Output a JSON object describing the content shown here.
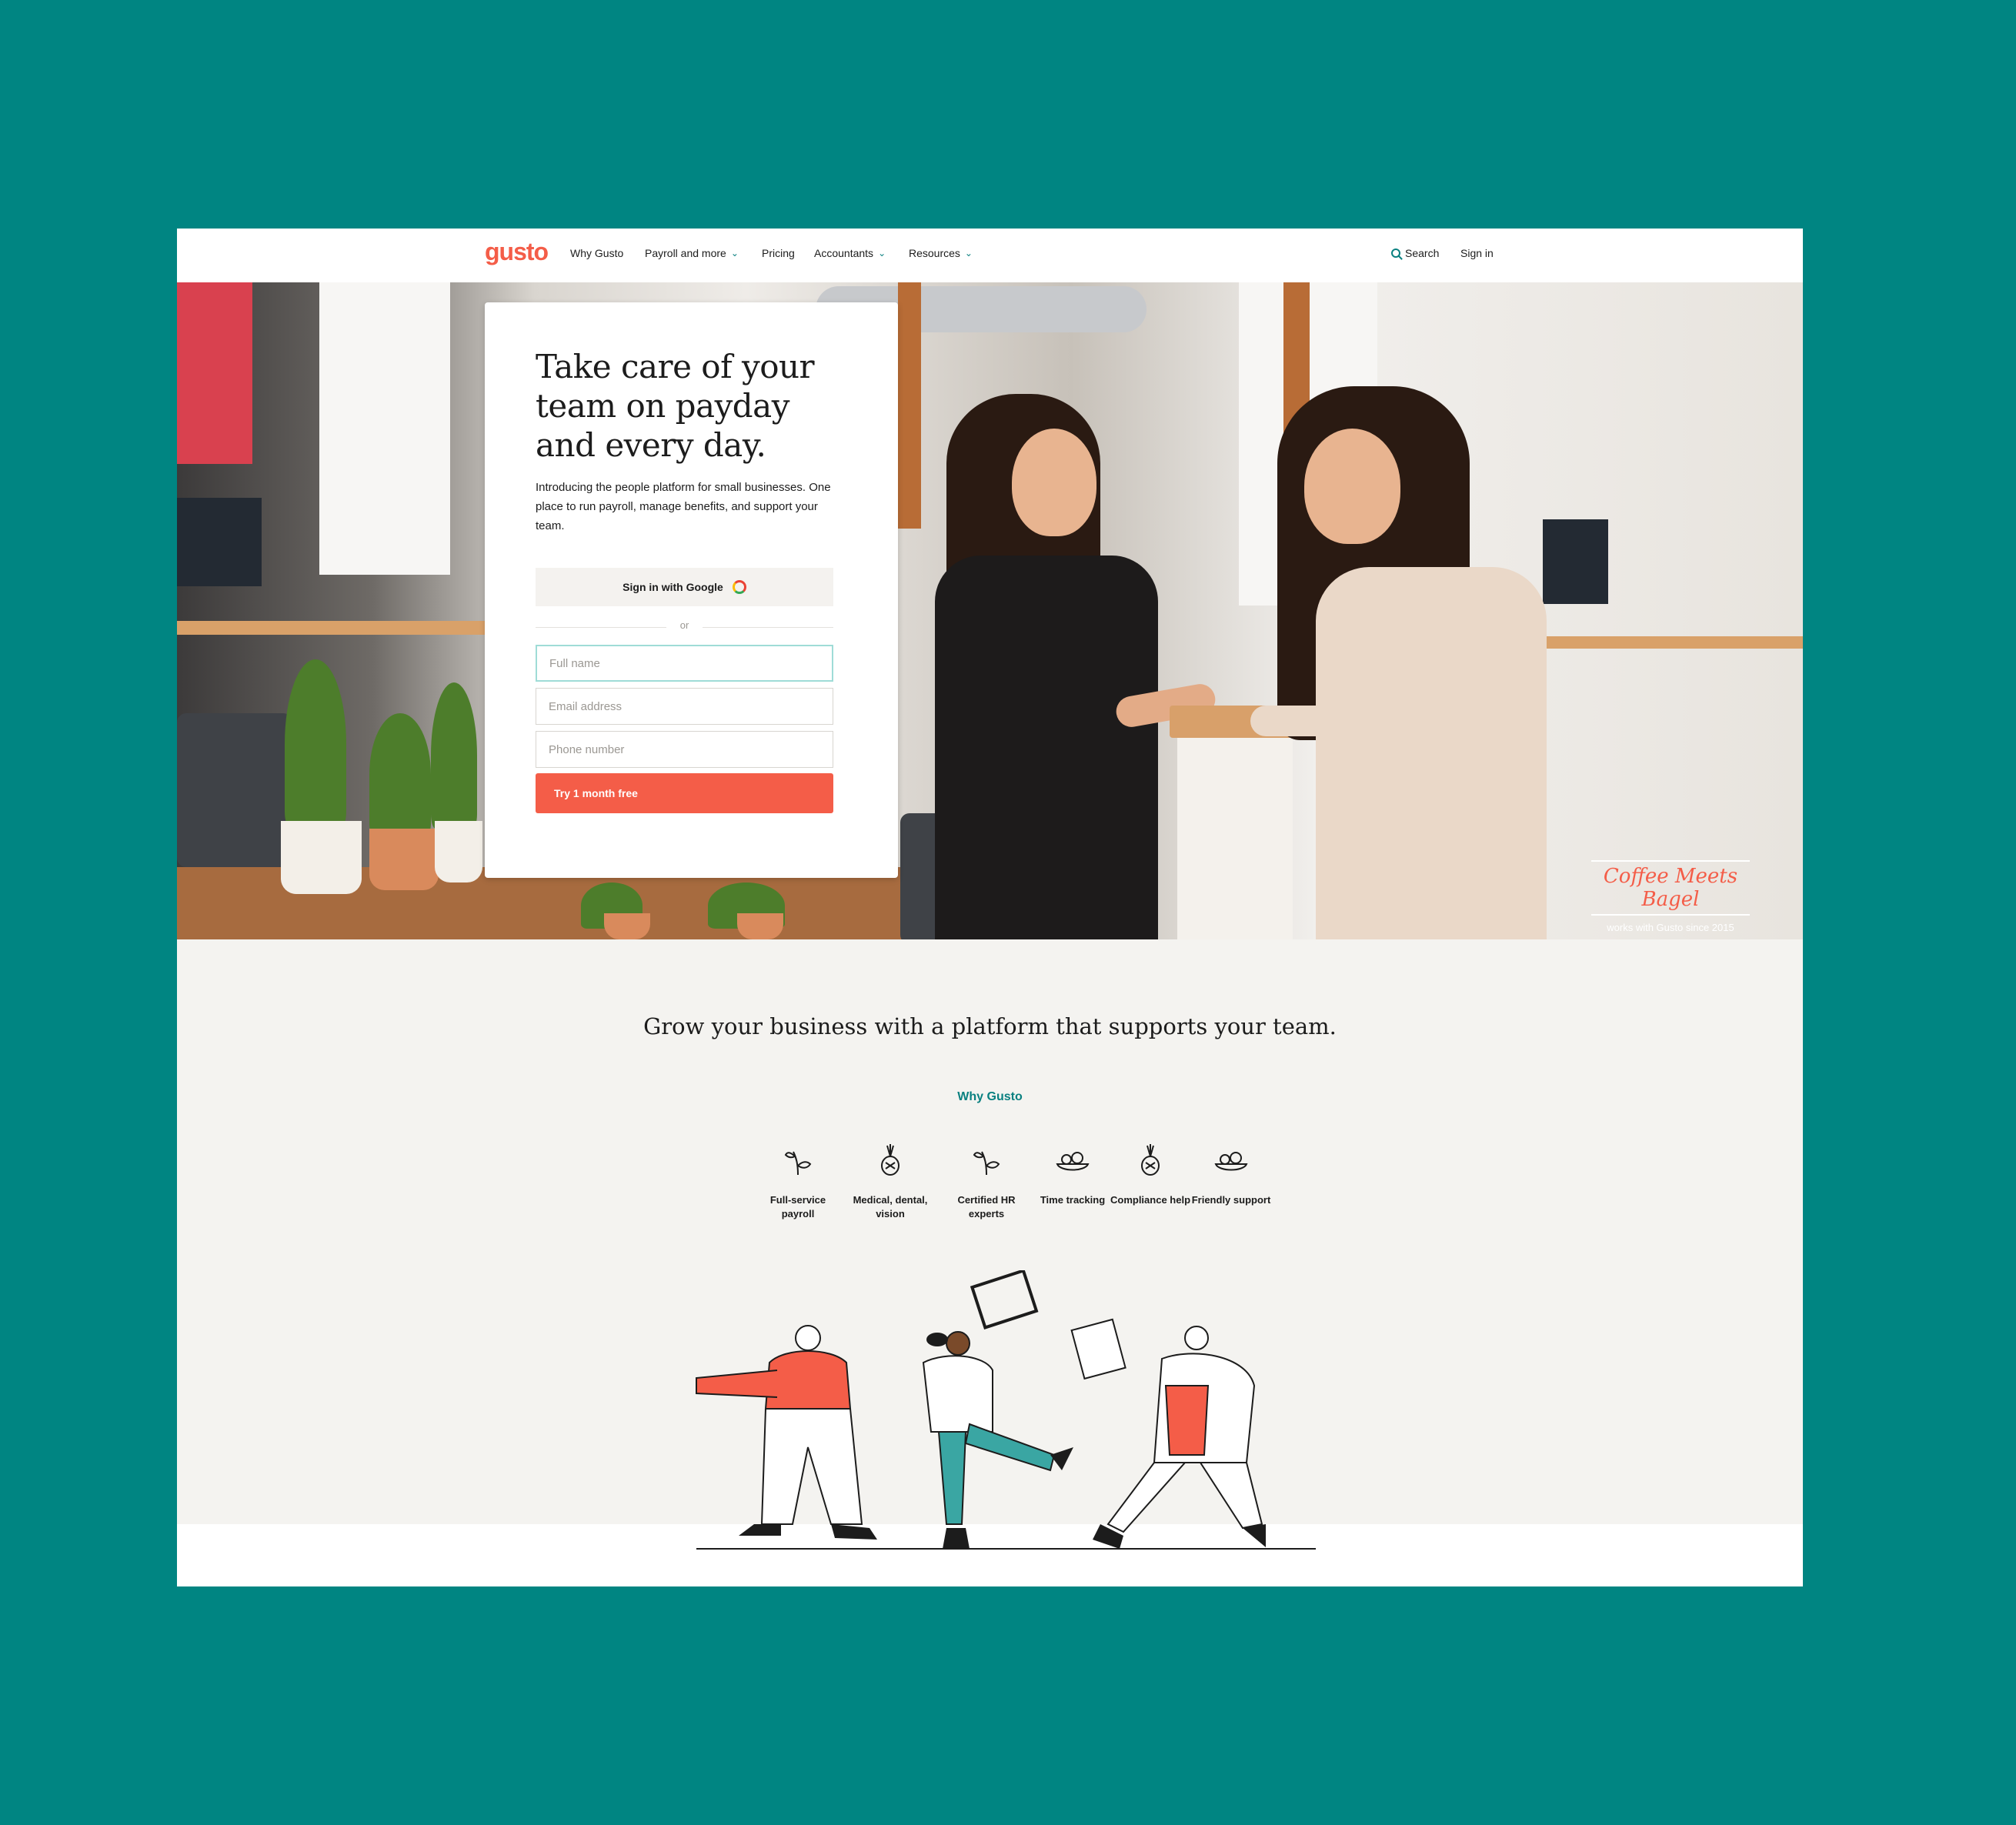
{
  "nav": {
    "logo": "gusto",
    "links": [
      "Why Gusto",
      "Payroll and more",
      "Pricing",
      "Accountants",
      "Resources"
    ],
    "search": "Search",
    "sign_in": "Sign in"
  },
  "hero": {
    "heading": "Take care of your team on payday and every day.",
    "intro": "Introducing the people platform for small businesses. One place to run payroll, manage benefits, and support your team.",
    "google_button": "Sign in with Google",
    "divider": "or",
    "fields": {
      "full_name_placeholder": "Full name",
      "email_placeholder": "Email address",
      "phone_placeholder": "Phone number"
    },
    "cta": "Try 1 month free",
    "badge_title": "Coffee Meets Bagel",
    "badge_sub": "works with Gusto since 2015"
  },
  "lower": {
    "heading": "Grow your business with a platform that supports your team.",
    "why_link": "Why Gusto",
    "features": [
      {
        "label": "Full-service payroll",
        "icon": "sprout-icon"
      },
      {
        "label": "Medical, dental, vision",
        "icon": "pineapple-icon"
      },
      {
        "label": "Certified HR experts",
        "icon": "sprout-icon"
      },
      {
        "label": "Time tracking",
        "icon": "salad-bowl-icon"
      },
      {
        "label": "Compliance help",
        "icon": "pineapple-icon"
      },
      {
        "label": "Friendly support",
        "icon": "salad-bowl-icon"
      }
    ]
  },
  "colors": {
    "background": "#008582",
    "brand": "#f45d48",
    "accent": "#0a8080"
  }
}
